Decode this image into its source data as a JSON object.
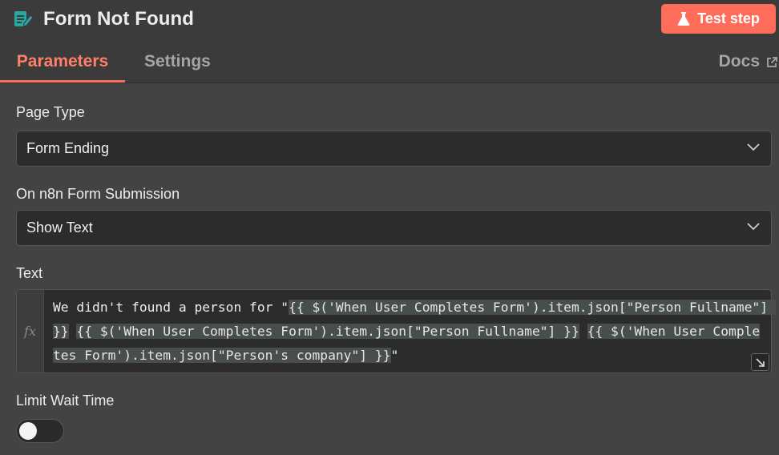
{
  "header": {
    "title": "Form Not Found",
    "node_icon": "form-edit-icon",
    "test_button_label": "Test step",
    "test_button_icon": "flask-icon",
    "accent_color": "#ff6d5a"
  },
  "tabs": [
    {
      "label": "Parameters",
      "active": true
    },
    {
      "label": "Settings",
      "active": false
    }
  ],
  "docs_label": "Docs",
  "fields": {
    "page_type": {
      "label": "Page Type",
      "value": "Form Ending"
    },
    "on_submission": {
      "label": "On n8n Form Submission",
      "value": "Show Text"
    },
    "text": {
      "label": "Text",
      "prefix": "We didn't found a person for \"",
      "expr1": "{{ $('When User Completes Form').item.json[\"Person Fullname\"] }}",
      "sep1": " ",
      "expr2": "{{ $('When User Completes Form').item.json[\"Person Fullname\"] }}",
      "sep2": " ",
      "expr3": "{{ $('When User Completes Form').item.json[\"Person's company\"] }}",
      "suffix": "\"",
      "fx_label": "fx"
    },
    "limit_wait_time": {
      "label": "Limit Wait Time",
      "enabled": false
    }
  }
}
